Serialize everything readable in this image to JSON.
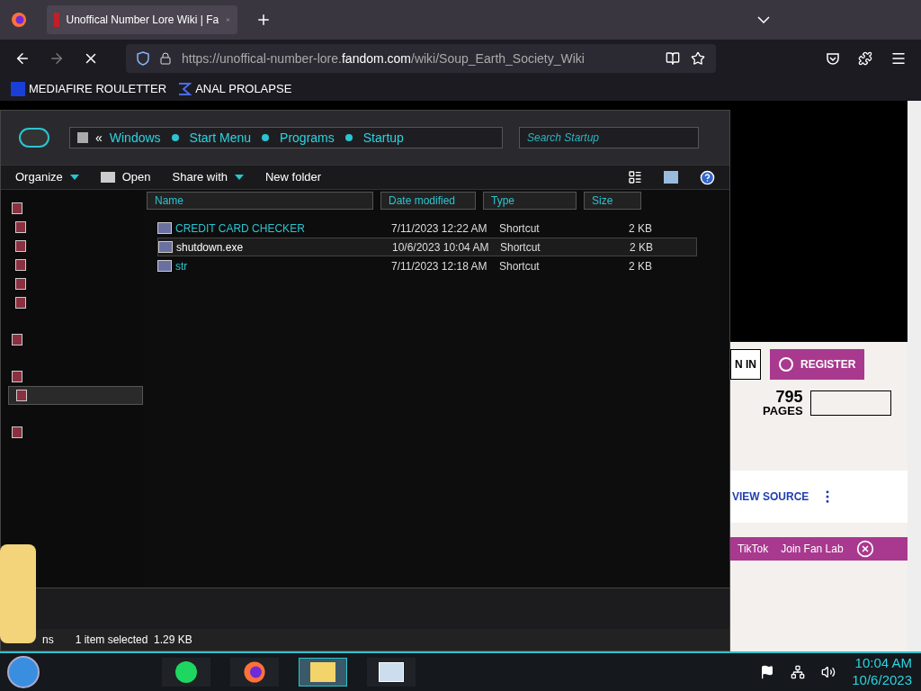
{
  "browser": {
    "tab": {
      "title": "Unoffical Number Lore Wiki | Fa",
      "selected": true
    },
    "url_host_pre": "https://unoffical-number-lore.",
    "url_host": "fandom.com",
    "url_path": "/wiki/Soup_Earth_Society_Wiki",
    "bookmarks": [
      {
        "label": "MEDIAFIRE ROULETTER",
        "kind": "mf"
      },
      {
        "label": "ANAL PROLAPSE",
        "kind": "sigma"
      }
    ]
  },
  "explorer": {
    "breadcrumb_prefix": "«",
    "breadcrumb": [
      "Windows",
      "Start Menu",
      "Programs",
      "Startup"
    ],
    "search": {
      "placeholder": "Search Startup"
    },
    "toolbar": [
      {
        "label": "Organize",
        "kind": "dropdown"
      },
      {
        "label": "Open",
        "kind": "icon"
      },
      {
        "label": "Share with",
        "kind": "dropdown"
      },
      {
        "label": "New folder",
        "kind": "plain"
      }
    ],
    "columns": [
      "Name",
      "Date modified",
      "Type",
      "Size"
    ],
    "nav_items": [
      {
        "selected": false,
        "children": [
          {
            "selected": false
          },
          {
            "selected": false
          },
          {
            "selected": false
          },
          {
            "selected": false
          },
          {
            "selected": false
          }
        ]
      },
      {
        "selected": false
      },
      {
        "selected": false,
        "children": [
          {
            "selected": true
          }
        ]
      },
      {
        "selected": false
      }
    ],
    "files": [
      {
        "name": "CREDIT CARD CHECKER",
        "date": "7/11/2023 12:22 AM",
        "type": "Shortcut",
        "size": "2 KB",
        "selected": false
      },
      {
        "name": "shutdown.exe",
        "date": "10/6/2023 10:04 AM",
        "type": "Shortcut",
        "size": "2 KB",
        "selected": true
      },
      {
        "name": "str",
        "date": "7/11/2023 12:18 AM",
        "type": "Shortcut",
        "size": "2 KB",
        "selected": false
      }
    ],
    "status_cut": "ns",
    "status": "1 item selected  1.29 KB"
  },
  "page": {
    "sign_in": "N IN",
    "register": "REGISTER",
    "pages_count": "795",
    "pages_label": "PAGES",
    "view_source": "VIEW SOURCE",
    "links": [
      "TikTok",
      "Join Fan Lab"
    ]
  },
  "taskbar": {
    "apps": [
      {
        "kind": "notes",
        "selected": false
      },
      {
        "kind": "firefox",
        "selected": false
      },
      {
        "kind": "folder",
        "selected": true
      },
      {
        "kind": "monitor",
        "selected": false
      }
    ],
    "time": "10:04 AM",
    "date": "10/6/2023"
  }
}
